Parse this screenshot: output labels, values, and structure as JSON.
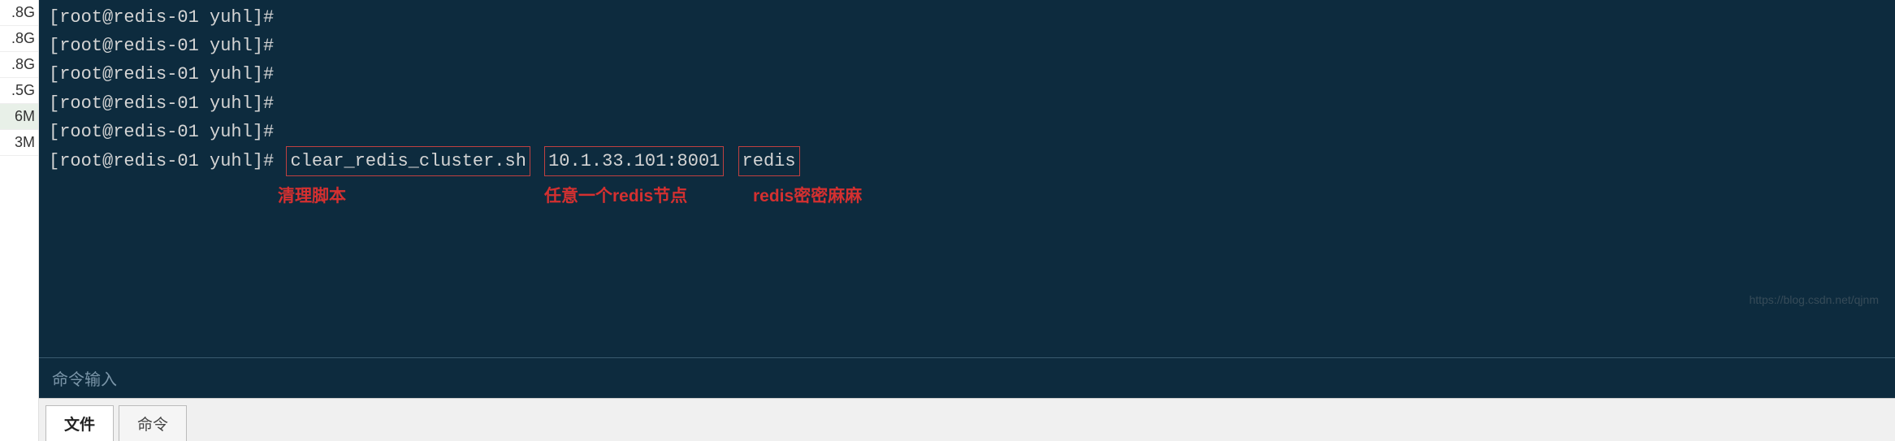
{
  "sidebar": {
    "items": [
      {
        "label": ".8G"
      },
      {
        "label": ".8G"
      },
      {
        "label": ".8G"
      },
      {
        "label": ".5G"
      },
      {
        "label": "6M",
        "highlight": true
      },
      {
        "label": "3M"
      }
    ]
  },
  "terminal": {
    "prompt": "[root@redis-01 yuhl]#",
    "lines": [
      "[root@redis-01 yuhl]#",
      "[root@redis-01 yuhl]#",
      "[root@redis-01 yuhl]#",
      "[root@redis-01 yuhl]#",
      "[root@redis-01 yuhl]#"
    ],
    "command": {
      "prompt": "[root@redis-01 yuhl]# ",
      "script": "clear_redis_cluster.sh",
      "node": "10.1.33.101:8001",
      "password": "redis"
    },
    "annotations": {
      "script_label": "清理脚本",
      "node_label": "任意一个redis节点",
      "password_label": "redis密密麻麻"
    },
    "input_placeholder": "命令输入"
  },
  "tabs": {
    "file": "文件",
    "command": "命令"
  },
  "watermark": "https://blog.csdn.net/qjnm"
}
